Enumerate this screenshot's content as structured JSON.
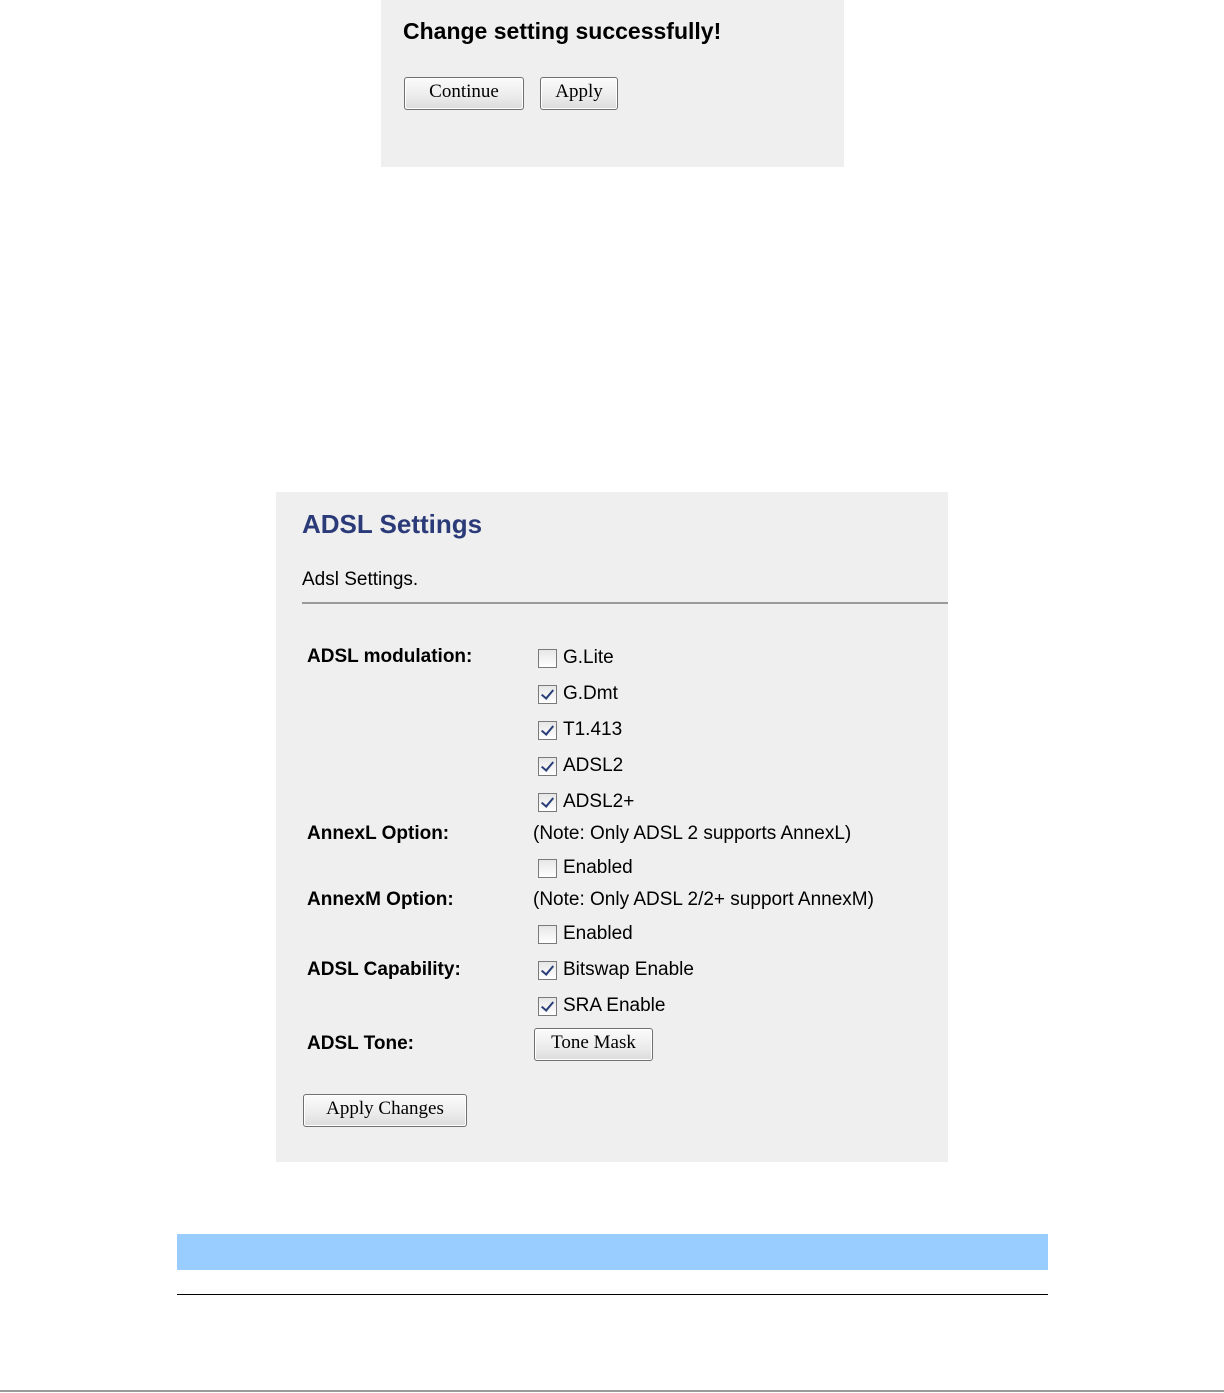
{
  "dialog": {
    "message": "Change setting successfully!",
    "continue_label": "Continue",
    "apply_label": "Apply"
  },
  "adsl": {
    "title": "ADSL Settings",
    "subtitle": "Adsl Settings.",
    "modulation": {
      "label": "ADSL modulation:",
      "options": [
        {
          "label": "G.Lite",
          "checked": false
        },
        {
          "label": "G.Dmt",
          "checked": true
        },
        {
          "label": "T1.413",
          "checked": true
        },
        {
          "label": "ADSL2",
          "checked": true
        },
        {
          "label": "ADSL2+",
          "checked": true
        }
      ]
    },
    "annexl": {
      "label": "AnnexL Option:",
      "note": "(Note: Only ADSL 2 supports AnnexL)",
      "option": {
        "label": "Enabled",
        "checked": false
      }
    },
    "annexm": {
      "label": "AnnexM Option:",
      "note": "(Note: Only ADSL 2/2+ support AnnexM)",
      "option": {
        "label": "Enabled",
        "checked": false
      }
    },
    "capability": {
      "label": "ADSL Capability:",
      "options": [
        {
          "label": "Bitswap Enable",
          "checked": true
        },
        {
          "label": "SRA Enable",
          "checked": true
        }
      ]
    },
    "tone": {
      "label": "ADSL Tone:",
      "button_label": "Tone Mask"
    },
    "apply_changes_label": "Apply Changes"
  },
  "colors": {
    "title": "#2b3a78",
    "panel_bg": "#efefef",
    "blue_bar": "#99ccff"
  }
}
